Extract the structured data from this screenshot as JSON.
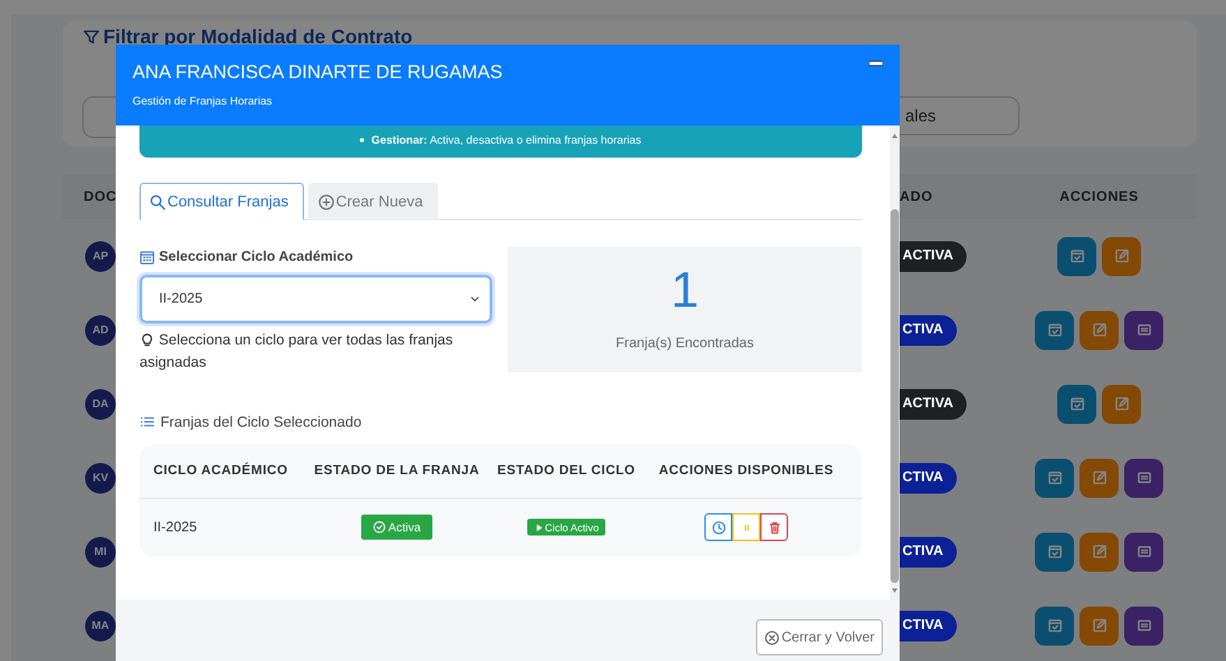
{
  "background_page": {
    "filter_title": "Filtrar por Modalidad de Contrato",
    "filter_button": "ales",
    "table": {
      "columns": [
        "DOC",
        "ADO",
        "ACCIONES"
      ],
      "rows": [
        {
          "avatar": "AP",
          "status": "ACTIVA",
          "color": "#1e2024",
          "actions": [
            {
              "kind": "calendar"
            },
            {
              "kind": "edit"
            }
          ]
        },
        {
          "avatar": "AD",
          "status": "CTIVA",
          "color": "#0c2196",
          "actions": [
            {
              "kind": "calendar"
            },
            {
              "kind": "edit"
            },
            {
              "kind": "details"
            }
          ]
        },
        {
          "avatar": "DA",
          "status": "ACTIVA",
          "color": "#1e2024",
          "actions": [
            {
              "kind": "calendar"
            },
            {
              "kind": "edit"
            }
          ]
        },
        {
          "avatar": "KV",
          "status": "CTIVA",
          "color": "#0c2196",
          "actions": [
            {
              "kind": "calendar"
            },
            {
              "kind": "edit"
            },
            {
              "kind": "details"
            }
          ]
        },
        {
          "avatar": "MI",
          "status": "CTIVA",
          "color": "#0c2196",
          "actions": [
            {
              "kind": "calendar"
            },
            {
              "kind": "edit"
            },
            {
              "kind": "details"
            }
          ]
        },
        {
          "avatar": "MA",
          "status": "CTIVA",
          "color": "#0c2196",
          "actions": [
            {
              "kind": "calendar"
            },
            {
              "kind": "edit"
            },
            {
              "kind": "details"
            }
          ]
        }
      ]
    }
  },
  "modal": {
    "title": "ANA FRANCISCA DINARTE DE RUGAMAS",
    "subtitle": "Gestión de Franjas Horarias",
    "info_alert": "**Gestionar:** Activa, desactiva o elimina franjas horarias",
    "tabs": [
      {
        "label": "Consultar Franjas",
        "selected": true
      },
      {
        "label": "Crear Nueva",
        "selected": false
      }
    ],
    "cycle_select": {
      "label": "Seleccionar Ciclo Académico",
      "value": "II-2025",
      "hint": "Selecciona un ciclo para ver todas las franjas asignadas"
    },
    "stat": {
      "count": "1",
      "label": "Franja(s) Encontradas"
    },
    "list_title": "Franjas del Ciclo Seleccionado",
    "table": {
      "columns": [
        "CICLO ACADÉMICO",
        "ESTADO DE LA FRANJA",
        "ESTADO DEL CICLO",
        "ACCIONES DISPONIBLES"
      ],
      "rows": [
        {
          "cycle": "II-2025",
          "franja_status": "Activa",
          "cycle_status": "Ciclo Activo",
          "actions": [
            {
              "kind": "schedule"
            },
            {
              "kind": "pause"
            },
            {
              "kind": "delete"
            }
          ]
        }
      ]
    },
    "footer_button": "Cerrar y Volver"
  }
}
